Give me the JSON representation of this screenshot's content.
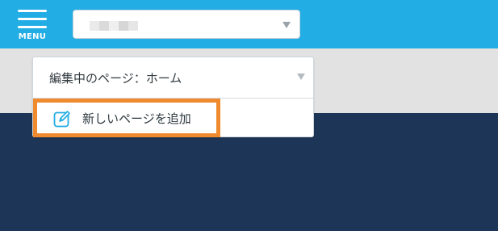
{
  "header": {
    "menu_label": "MENU",
    "site_select": {
      "value": "",
      "icon": "chevron-down-icon"
    }
  },
  "page_selector": {
    "current_label": "編集中のページ：ホーム",
    "icon": "chevron-down-icon"
  },
  "menu": {
    "add_page_label": "新しいページを追加",
    "add_page_icon": "edit-icon",
    "highlight_color": "#ef8a2f"
  },
  "colors": {
    "header": "#22ade4",
    "band": "#e2e2e2",
    "background": "#1d3557",
    "icon_accent": "#22ade4"
  }
}
